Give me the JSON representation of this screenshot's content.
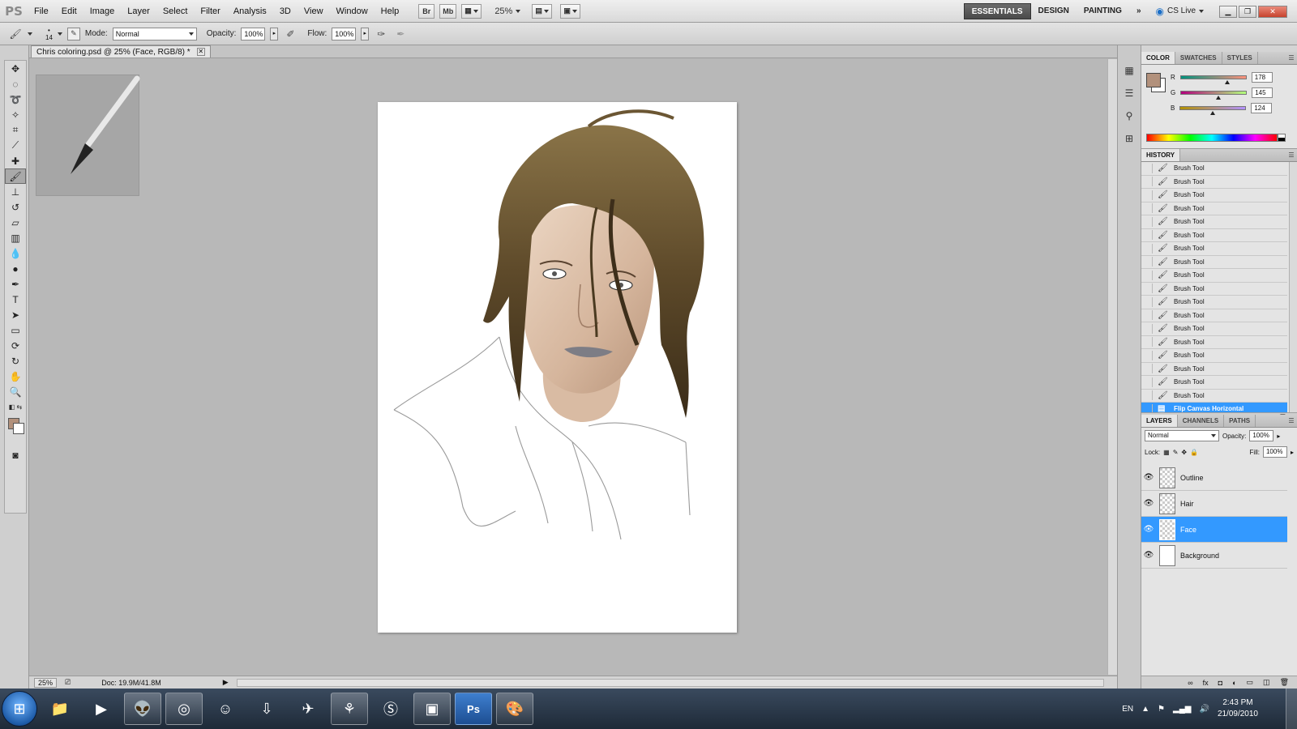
{
  "app": {
    "logo": "PS",
    "menu": [
      "File",
      "Edit",
      "Image",
      "Layer",
      "Select",
      "Filter",
      "Analysis",
      "3D",
      "View",
      "Window",
      "Help"
    ],
    "bridge_btn": "Br",
    "minibridge_btn": "Mb",
    "zoom": "25%",
    "workspaces": [
      "ESSENTIALS",
      "DESIGN",
      "PAINTING"
    ],
    "active_workspace": "ESSENTIALS",
    "more": "»",
    "cs_live": "CS Live"
  },
  "options_bar": {
    "brush_size": "14",
    "mode_label": "Mode:",
    "mode_value": "Normal",
    "opacity_label": "Opacity:",
    "opacity_value": "100%",
    "flow_label": "Flow:",
    "flow_value": "100%"
  },
  "document": {
    "tab_title": "Chris coloring.psd @ 25% (Face, RGB/8) *",
    "status_zoom": "25%",
    "status_doc": "Doc: 19.9M/41.8M"
  },
  "color_panel": {
    "tabs": [
      "COLOR",
      "SWATCHES",
      "STYLES"
    ],
    "fg_color": "#b2917c",
    "r_label": "R",
    "r_value": "178",
    "g_label": "G",
    "g_value": "145",
    "b_label": "B",
    "b_value": "124"
  },
  "history_panel": {
    "title": "HISTORY",
    "items": [
      "Brush Tool",
      "Brush Tool",
      "Brush Tool",
      "Brush Tool",
      "Brush Tool",
      "Brush Tool",
      "Brush Tool",
      "Brush Tool",
      "Brush Tool",
      "Brush Tool",
      "Brush Tool",
      "Brush Tool",
      "Brush Tool",
      "Brush Tool",
      "Brush Tool",
      "Brush Tool",
      "Brush Tool",
      "Brush Tool"
    ],
    "active_item": "Flip Canvas Horizontal"
  },
  "layers_panel": {
    "tabs": [
      "LAYERS",
      "CHANNELS",
      "PATHS"
    ],
    "blend_mode": "Normal",
    "opacity_label": "Opacity:",
    "opacity_value": "100%",
    "lock_label": "Lock:",
    "fill_label": "Fill:",
    "fill_value": "100%",
    "layers": [
      {
        "name": "Outline"
      },
      {
        "name": "Hair"
      },
      {
        "name": "Face"
      },
      {
        "name": "Background"
      }
    ],
    "active_layer": "Face"
  },
  "taskbar": {
    "language": "EN",
    "time": "2:43 PM",
    "date": "21/09/2010"
  }
}
